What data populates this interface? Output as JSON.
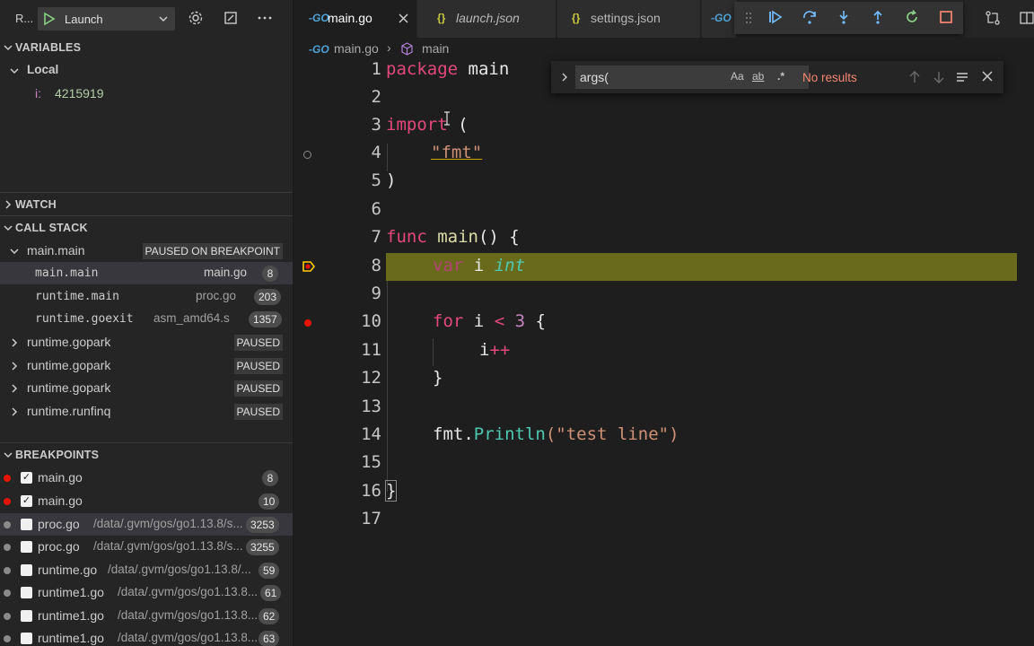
{
  "debug_toolbar": {
    "run_label": "R...",
    "config_name": "Launch"
  },
  "variables": {
    "header": "VARIABLES",
    "local_label": "Local",
    "items": [
      {
        "name": "i:",
        "value": "4215919"
      }
    ]
  },
  "watch": {
    "header": "WATCH"
  },
  "call_stack": {
    "header": "CALL STACK",
    "thread": {
      "name": "main.main",
      "status": "PAUSED ON BREAKPOINT"
    },
    "frames": [
      {
        "name": "main.main",
        "file": "main.go",
        "line": "8"
      },
      {
        "name": "runtime.main",
        "file": "proc.go",
        "line": "203"
      },
      {
        "name": "runtime.goexit",
        "file": "asm_amd64.s",
        "line": "1357"
      }
    ],
    "goroutines": [
      {
        "name": "runtime.gopark",
        "status": "PAUSED"
      },
      {
        "name": "runtime.gopark",
        "status": "PAUSED"
      },
      {
        "name": "runtime.gopark",
        "status": "PAUSED"
      },
      {
        "name": "runtime.runfinq",
        "status": "PAUSED"
      }
    ]
  },
  "breakpoints": {
    "header": "BREAKPOINTS",
    "items": [
      {
        "file": "main.go",
        "path": "",
        "line": "8",
        "checked": true,
        "active": true
      },
      {
        "file": "main.go",
        "path": "",
        "line": "10",
        "checked": true,
        "active": true
      },
      {
        "file": "proc.go",
        "path": "/data/.gvm/gos/go1.13.8/s...",
        "line": "3253",
        "checked": false,
        "active": false
      },
      {
        "file": "proc.go",
        "path": "/data/.gvm/gos/go1.13.8/s...",
        "line": "3255",
        "checked": false,
        "active": false
      },
      {
        "file": "runtime.go",
        "path": "/data/.gvm/gos/go1.13.8/...",
        "line": "59",
        "checked": false,
        "active": false
      },
      {
        "file": "runtime1.go",
        "path": "/data/.gvm/gos/go1.13.8...",
        "line": "61",
        "checked": false,
        "active": false
      },
      {
        "file": "runtime1.go",
        "path": "/data/.gvm/gos/go1.13.8...",
        "line": "62",
        "checked": false,
        "active": false
      },
      {
        "file": "runtime1.go",
        "path": "/data/.gvm/gos/go1.13.8...",
        "line": "63",
        "checked": false,
        "active": false
      }
    ]
  },
  "tabs": [
    {
      "icon": "-GO",
      "label": "main.go",
      "active": true
    },
    {
      "icon": "{}",
      "label": "launch.json",
      "active": false
    },
    {
      "icon": "{}",
      "label": "settings.json",
      "active": false
    },
    {
      "icon": "-GO",
      "label": "",
      "active": false
    }
  ],
  "breadcrumb": {
    "file_icon": "-GO",
    "file": "main.go",
    "symbol": "main"
  },
  "find_widget": {
    "query": "args(",
    "match_case": "Aa",
    "whole_word": "ab",
    "regex": ".*",
    "status": "No results"
  },
  "code": {
    "current_line": 8,
    "lines": [
      "1",
      "2",
      "3",
      "4",
      "5",
      "6",
      "7",
      "8",
      "9",
      "10",
      "11",
      "12",
      "13",
      "14",
      "15",
      "16",
      "17"
    ],
    "text": {
      "package": "package",
      "main": "main",
      "import": "import",
      "paren_open": "(",
      "fmt_str": "\"fmt\"",
      "paren_close": ")",
      "func": "func",
      "main_fn": "main",
      "fn_sig": "() {",
      "var": "var",
      "i": "i",
      "int": "int",
      "for": "for",
      "lt": "<",
      "three": "3",
      "brace_open": "{",
      "i_inc": "i",
      "plusplus": "++",
      "brace_close": "}",
      "fmt_pkg": "fmt.",
      "println": "Println",
      "println_args": "(\"test line\")",
      "final_brace": "}"
    }
  },
  "colors": {
    "accent": "#007acc",
    "breakpoint": "#e51400",
    "current_line": "#6a6a1c",
    "debug_arrow": "#ffcc00"
  }
}
